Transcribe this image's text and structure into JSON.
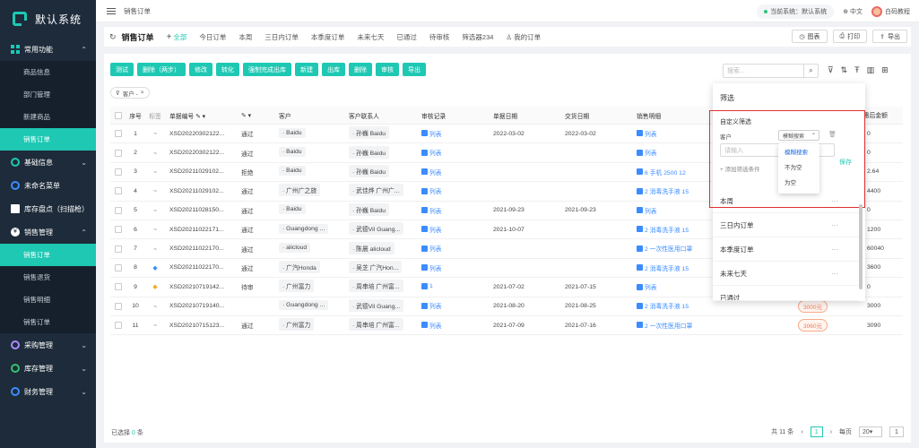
{
  "app": {
    "title": "默认系统"
  },
  "topbar": {
    "breadcrumb": "销售订单",
    "system_label": "当前系统：默认系统",
    "language": "中文",
    "user": "白码教程"
  },
  "sidebar": {
    "groups": [
      {
        "label": "常用功能",
        "icon": "grid-icon",
        "expanded": true,
        "items": [
          "商品信息",
          "部门管理",
          "新建商品",
          "销售订单"
        ],
        "active": "销售订单"
      },
      {
        "label": "基础信息",
        "icon": "circle-icon",
        "expanded": false
      },
      {
        "label": "未命名菜单",
        "icon": "circle-icon",
        "expanded": false
      },
      {
        "label": "库存盘点（扫描枪）",
        "icon": "building-icon",
        "expanded": false
      },
      {
        "label": "销售管理",
        "icon": "yen-icon",
        "expanded": true,
        "items": [
          "销售订单",
          "销售退货",
          "销售明细",
          "销售订单"
        ],
        "active": "销售订单"
      },
      {
        "label": "采购管理",
        "icon": "circle-icon",
        "expanded": false
      },
      {
        "label": "库存管理",
        "icon": "circle-icon",
        "expanded": false
      },
      {
        "label": "财务管理",
        "icon": "circle-icon",
        "expanded": false
      }
    ]
  },
  "tabs": {
    "page_title": "销售订单",
    "items": [
      "全部",
      "今日订单",
      "本周",
      "三日内订单",
      "本季度订单",
      "未来七天",
      "已通过",
      "待审核",
      "筛选器234",
      "我的订单"
    ],
    "active": "全部"
  },
  "actions": {
    "chart": "图表",
    "print": "打印",
    "export": "导出"
  },
  "toolbar": [
    "测试",
    "删除（两步）",
    "修改",
    "转化",
    "强制完成出库",
    "新建",
    "出库",
    "删除",
    "审核",
    "导出"
  ],
  "filter_tag": "客户 -",
  "search": {
    "placeholder": "搜索..."
  },
  "table": {
    "headers": [
      "序号",
      "标签",
      "单据编号",
      "",
      "客户",
      "客户联系人",
      "审核记录",
      "单据日期",
      "交货日期",
      "销售明细"
    ],
    "rows": [
      {
        "no": "1",
        "tag": "link",
        "code": "XSD20220302122...",
        "status": "通过",
        "customer": "Baidu",
        "contact": "孙巍 Baidu",
        "audit": "列表",
        "date1": "2022-03-02",
        "date2": "2022-03-02",
        "detail": "列表",
        "amount": "0"
      },
      {
        "no": "2",
        "tag": "link",
        "code": "XSD20220302122...",
        "status": "通过",
        "customer": "Baidu",
        "contact": "孙巍 Baidu",
        "audit": "列表",
        "date1": "",
        "date2": "",
        "detail": "列表",
        "amount": "0"
      },
      {
        "no": "3",
        "tag": "link",
        "code": "XSD20211029102...",
        "status": "拒绝",
        "customer": "Baidu",
        "contact": "孙巍 Baidu",
        "audit": "列表",
        "date1": "",
        "date2": "",
        "detail": "6  手机 2500 12",
        "amount": "2.64"
      },
      {
        "no": "4",
        "tag": "link",
        "code": "XSD20211029102...",
        "status": "通过",
        "customer": "广州广之旅",
        "contact": "武佳烨 广州广...",
        "audit": "列表",
        "date1": "",
        "date2": "",
        "detail": "2  消毒洗手液 15",
        "amount": "4400"
      },
      {
        "no": "5",
        "tag": "link",
        "code": "XSD20211028150...",
        "status": "通过",
        "customer": "Baidu",
        "contact": "孙巍 Baidu",
        "audit": "列表",
        "date1": "2021-09-23",
        "date2": "2021-09-23",
        "detail": "列表",
        "amount": "0"
      },
      {
        "no": "6",
        "tag": "link",
        "code": "XSD20211022171...",
        "status": "通过",
        "customer": "Guangdong ...",
        "contact": "武德Vil Guang...",
        "audit": "列表",
        "date1": "2021-10-07",
        "date2": "",
        "detail": "2  消毒洗手液 15",
        "amount": "1200"
      },
      {
        "no": "7",
        "tag": "link",
        "code": "XSD20211022170...",
        "status": "通过",
        "customer": "alicloud",
        "contact": "陈晨 alicloud",
        "audit": "列表",
        "date1": "",
        "date2": "",
        "detail": "2  一次性医用口罩",
        "amount": "60040"
      },
      {
        "no": "8",
        "tag": "blue",
        "code": "XSD20211022170...",
        "status": "通过",
        "customer": "广汽Honda",
        "contact": "吴芝 广汽Hon...",
        "audit": "列表",
        "date1": "",
        "date2": "",
        "detail": "2  消毒洗手液 15",
        "amount": "3600"
      },
      {
        "no": "9",
        "tag": "orange",
        "code": "XSD20210719142...",
        "status": "待审",
        "customer": "广州富力",
        "contact": "周串培 广州富...",
        "audit": "1",
        "date1": "2021-07-02",
        "date2": "2021-07-15",
        "detail": "列表",
        "amount": "0"
      },
      {
        "no": "10",
        "tag": "link",
        "code": "XSD20210719140...",
        "status": "",
        "customer": "Guangdong ...",
        "contact": "武德Vil Guang...",
        "audit": "列表",
        "date1": "2021-08-20",
        "date2": "2021-08-25",
        "detail": "2  消毒洗手液 15",
        "amount": "3000",
        "amount_tag": "3000元"
      },
      {
        "no": "11",
        "tag": "link",
        "code": "XSD20210715123...",
        "status": "通过",
        "customer": "广州富力",
        "contact": "周串培 广州富...",
        "audit": "列表",
        "date1": "2021-07-09",
        "date2": "2021-07-16",
        "detail": "2  一次性医用口罩",
        "amount": "3090",
        "amount_tag": "3060元"
      }
    ],
    "right_header": "优惠后金额"
  },
  "filter_panel": {
    "title": "筛选",
    "custom_title": "自定义筛选",
    "field": "客户",
    "mode": "模糊搜索",
    "input_placeholder": "请输入",
    "add_label": "添加筛选条件",
    "save_label": "保存",
    "dropdown": [
      "模糊搜索",
      "不为空",
      "为空"
    ],
    "items": [
      "本周",
      "三日内订单",
      "本季度订单",
      "未来七天",
      "已通过"
    ]
  },
  "footer": {
    "selected_prefix": "已选择",
    "selected_count": "0",
    "selected_suffix": "条",
    "total": "共 11 条",
    "per_page_label": "每页",
    "per_page": "20",
    "page": "1",
    "goto_input": "1",
    "prev": "‹",
    "next": "›"
  },
  "colors": {
    "accent": "#1ec8b3",
    "sidebar": "#1d2b3a",
    "highlight_box": "#e03030",
    "link": "#3b8cff"
  }
}
